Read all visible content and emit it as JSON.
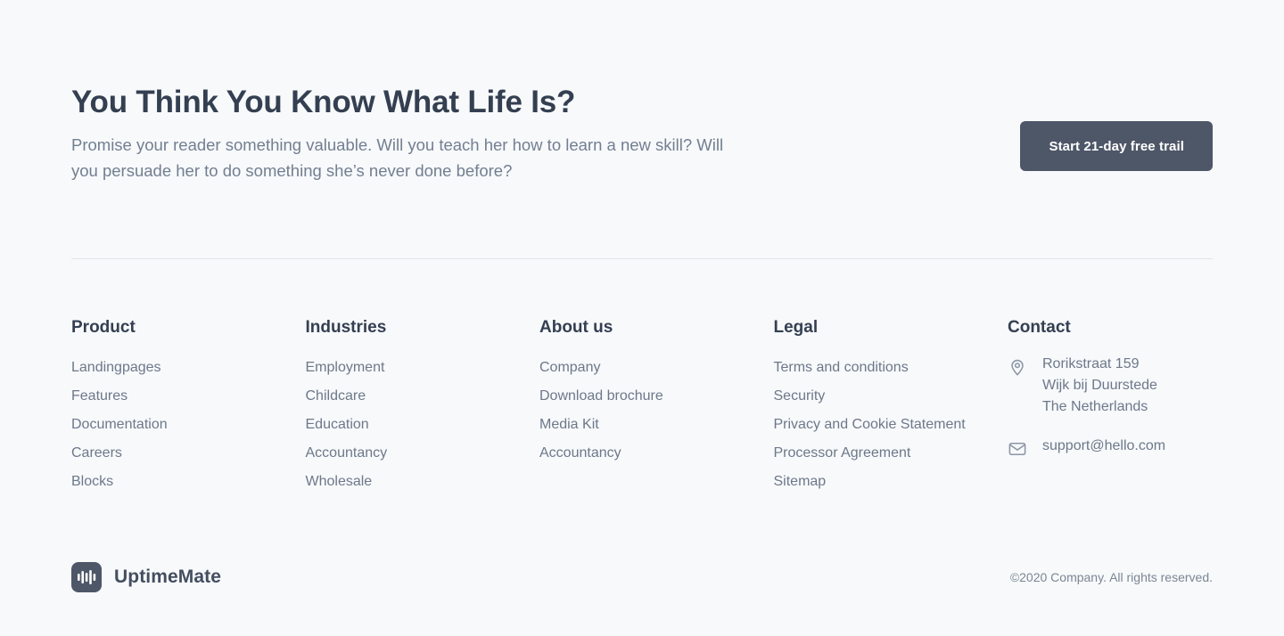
{
  "cta": {
    "title": "You Think You Know What Life Is?",
    "subtitle": "Promise your reader something valuable. Will you teach her how to learn a new skill? Will you persuade her to do something she’s never done before?",
    "button_label": "Start 21-day free trail"
  },
  "footer": {
    "columns": [
      {
        "title": "Product",
        "links": [
          "Landingpages",
          "Features",
          "Documentation",
          "Careers",
          "Blocks"
        ]
      },
      {
        "title": "Industries",
        "links": [
          "Employment",
          "Childcare",
          "Education",
          "Accountancy",
          "Wholesale"
        ]
      },
      {
        "title": "About us",
        "links": [
          "Company",
          "Download brochure",
          "Media Kit",
          "Accountancy"
        ]
      },
      {
        "title": "Legal",
        "links": [
          "Terms and conditions",
          "Security",
          "Privacy and Cookie Statement",
          "Processor Agreement",
          "Sitemap"
        ]
      }
    ],
    "contact": {
      "title": "Contact",
      "address_icon": "map-pin-icon",
      "address_lines": [
        "Rorikstraat 159",
        "Wijk bij Duurstede",
        "The Netherlands"
      ],
      "email_icon": "envelope-icon",
      "email": "support@hello.com"
    },
    "brand": {
      "logo_icon": "waveform-logo-icon",
      "name": "UptimeMate"
    },
    "copyright": "©2020 Company. All rights reserved."
  },
  "colors": {
    "background": "#f7f9fb",
    "heading": "#343f51",
    "body_text": "#6d7889",
    "button_background": "#4e5768",
    "button_text": "#ffffff",
    "divider": "#e3e6ea"
  }
}
